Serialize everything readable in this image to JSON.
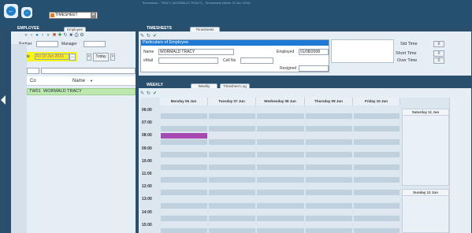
{
  "app": {
    "title_input": "TIMESHEET",
    "faded_title": "Timesheets - TRACY (WORMALD TRACY) - Timesheets (Week 10 Jun 2016)"
  },
  "employee": {
    "section_title": "EMPLOYEE",
    "tab_label": "Employee",
    "partner_label": "Partner",
    "manager_label": "Manager",
    "we_date_label": "W/e Date",
    "we_date_value": "Fri 10 Jun 2016",
    "ellipsis_label": "...",
    "prev_label": "<",
    "today_label": "Today",
    "next_label": ">",
    "columns": {
      "code": "Co",
      "name": "Name"
    },
    "rows": [
      {
        "code": "TW01",
        "name": "WORMALD TRACY"
      }
    ]
  },
  "timesheets": {
    "section_title": "TIMESHEETS",
    "tab_label": "Timesheets",
    "card_title": "Particulars of Employee",
    "name_label": "Name",
    "name_value": "WORMALD TRACY",
    "employed_label": "Employed",
    "employed_value": "01/08/2008",
    "email_label": "eMail",
    "email_value": "",
    "cell_label": "Cell No",
    "cell_value": "",
    "resigned_label": "Resigned",
    "resigned_value": "",
    "std_time_label": "Std Time",
    "std_time_value": "0",
    "short_time_label": "Short Time",
    "short_time_value": "0",
    "over_time_label": "Over Time",
    "over_time_value": "0"
  },
  "weekly": {
    "section_title": "WEEKLY",
    "tabs": [
      "Weekly",
      "Timesheet Log"
    ],
    "days": [
      "Monday 06 Jun",
      "Tuesday 07 Jun",
      "Wednesday 08 Jun",
      "Thursday 09 Jun",
      "Friday 10 Jun"
    ],
    "weekend": [
      "Saturday 11 Jun",
      "Sunday 12 Jun"
    ],
    "times": [
      "06:00",
      "07:00",
      "08:00",
      "09:00",
      "10:00",
      "11:00",
      "12:00",
      "13:00",
      "14:00",
      "15:00"
    ],
    "event_color": "#a64ab1"
  },
  "colors": {
    "highlight": "#f5f51e",
    "selected_row": "#bfe8b0",
    "card_header": "#1e79d4"
  }
}
